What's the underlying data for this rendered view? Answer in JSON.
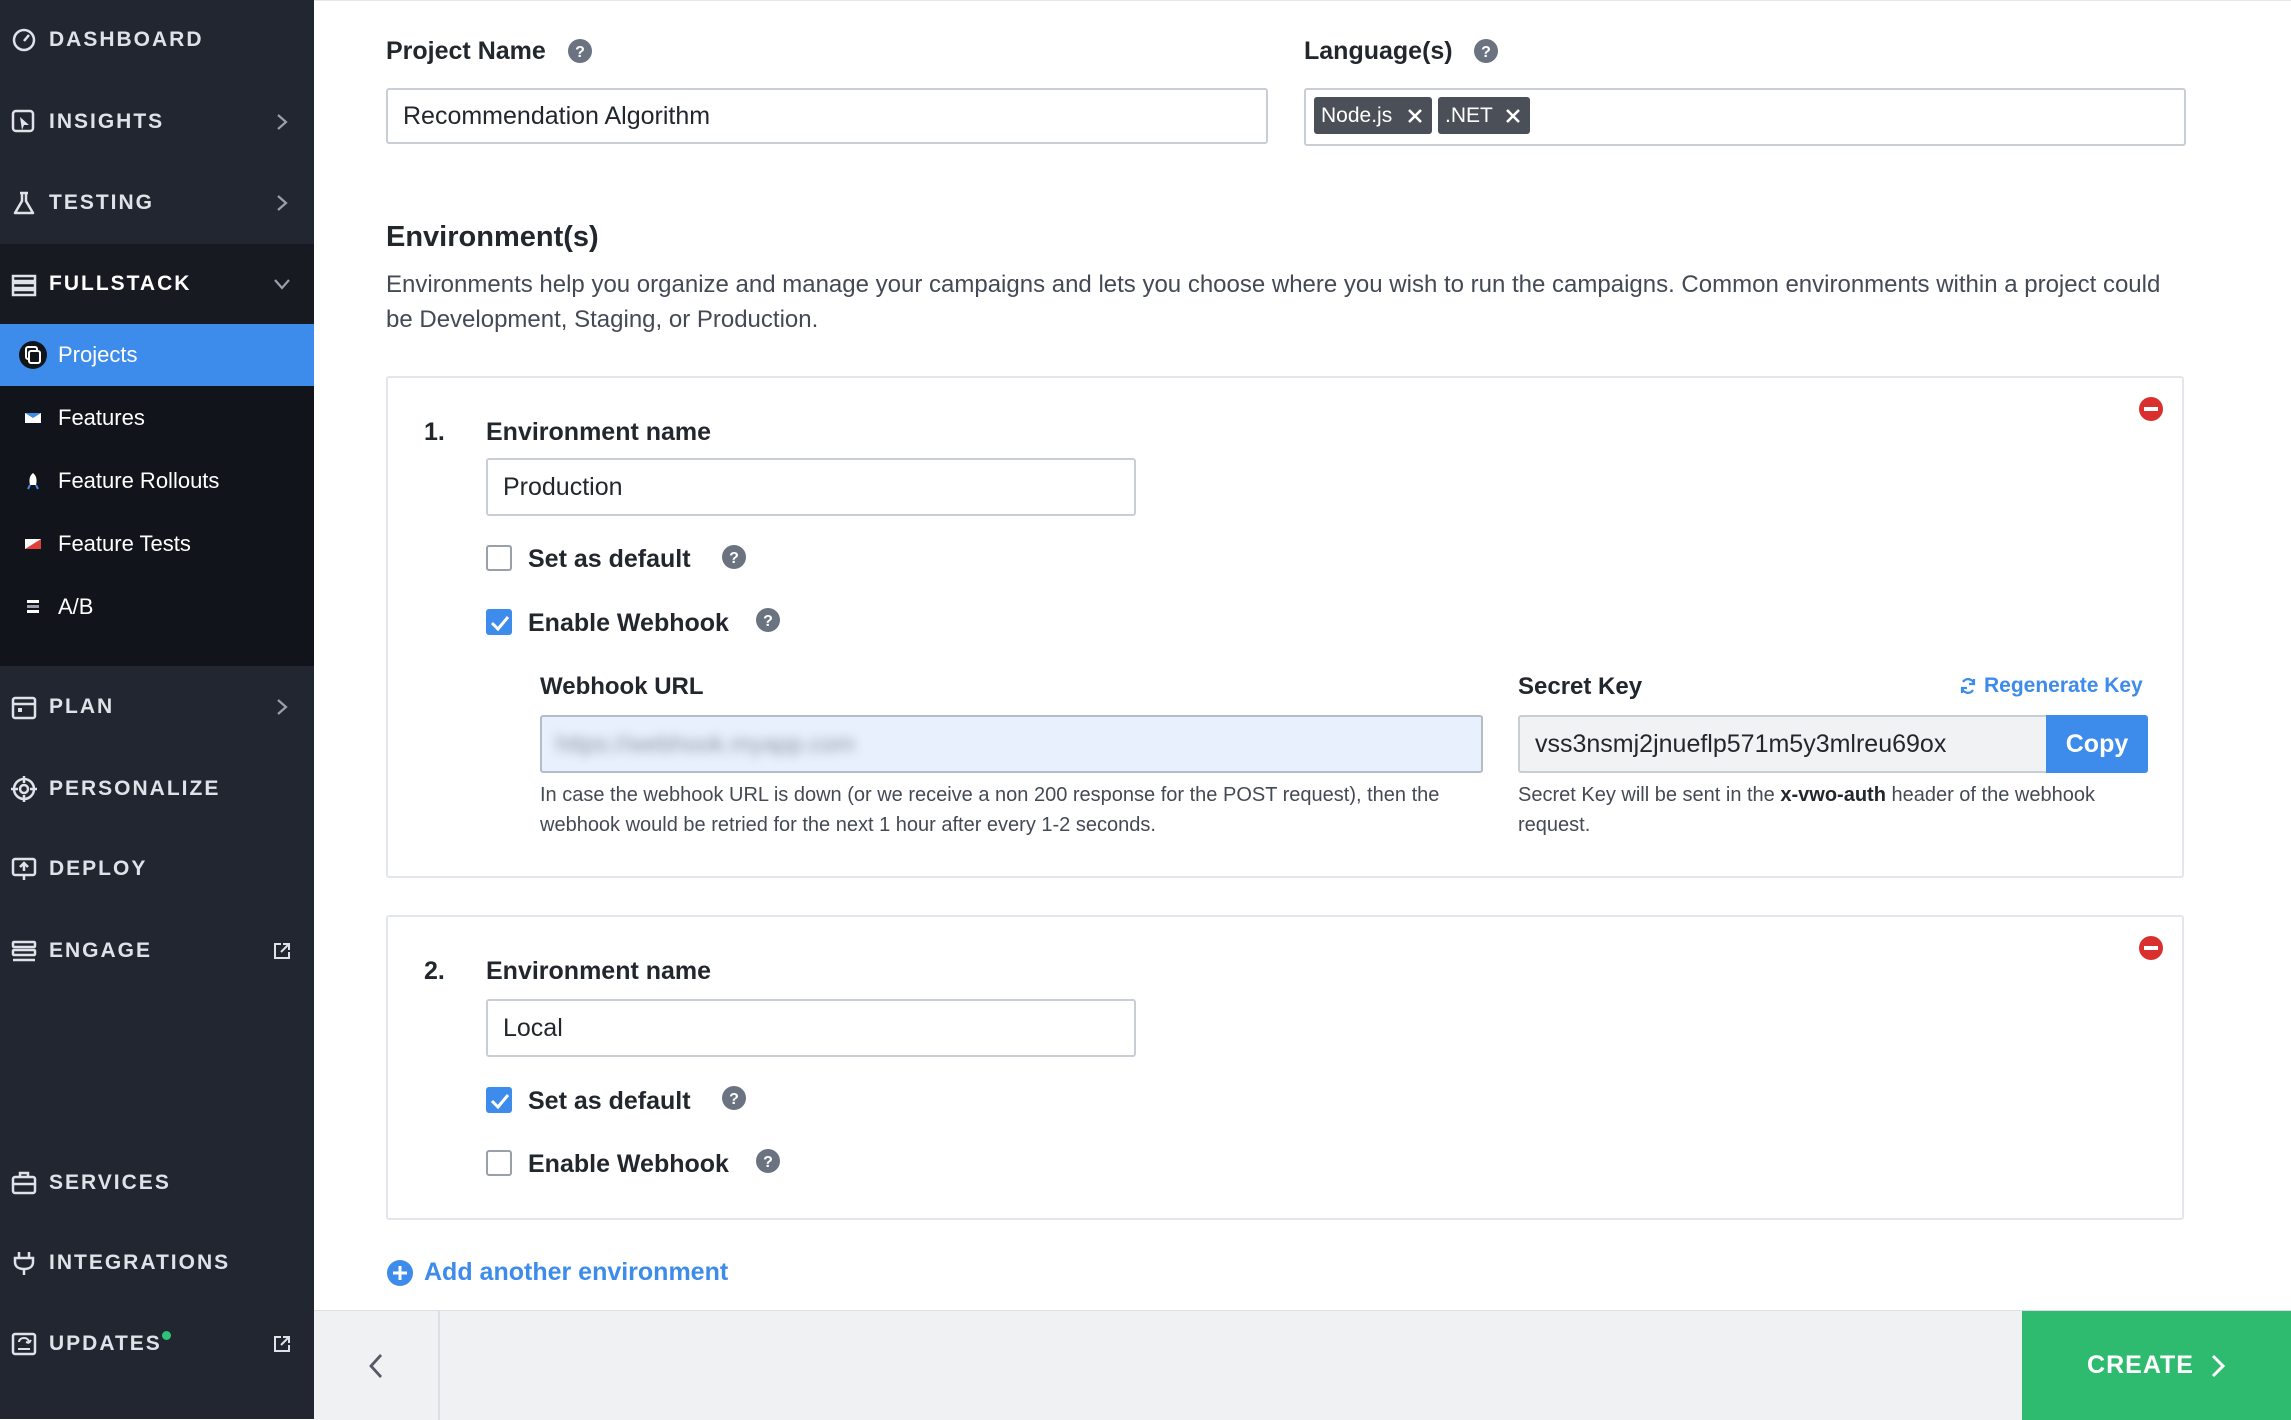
{
  "colors": {
    "sidebar_bg": "#222631",
    "accent_blue": "#3d8bea",
    "create_green": "#2fbb6f",
    "remove_red": "#d9302f",
    "updates_dot": "#2fc37a"
  },
  "sidebar": {
    "items": [
      {
        "label": "DASHBOARD",
        "icon": "gauge-icon"
      },
      {
        "label": "INSIGHTS",
        "icon": "cursor-click-icon"
      },
      {
        "label": "TESTING",
        "icon": "flask-icon"
      },
      {
        "label": "FULLSTACK",
        "icon": "stack-icon",
        "expanded": true
      },
      {
        "label": "PLAN",
        "icon": "calendar-icon"
      },
      {
        "label": "PERSONALIZE",
        "icon": "target-icon"
      },
      {
        "label": "DEPLOY",
        "icon": "deploy-icon"
      },
      {
        "label": "ENGAGE",
        "icon": "engage-icon"
      },
      {
        "label": "SERVICES",
        "icon": "briefcase-icon"
      },
      {
        "label": "INTEGRATIONS",
        "icon": "plug-icon"
      },
      {
        "label": "UPDATES",
        "icon": "updates-icon"
      }
    ],
    "fullstack_sub": [
      {
        "label": "Projects",
        "icon": "projects-icon",
        "active": true
      },
      {
        "label": "Features",
        "icon": "features-icon"
      },
      {
        "label": "Feature Rollouts",
        "icon": "rollouts-icon"
      },
      {
        "label": "Feature Tests",
        "icon": "feature-tests-icon"
      },
      {
        "label": "A/B",
        "icon": "ab-icon"
      }
    ]
  },
  "form": {
    "project_name_label": "Project Name",
    "project_name_value": "Recommendation Algorithm",
    "languages_label": "Language(s)",
    "languages": [
      "Node.js",
      ".NET"
    ],
    "environments_title": "Environment(s)",
    "environments_description": "Environments help you organize and manage your campaigns and lets you choose where you wish to run the campaigns. Common environments within a project could be Development, Staging, or Production."
  },
  "environments": [
    {
      "number": "1.",
      "name_label": "Environment name",
      "name_value": "Production",
      "set_default_label": "Set as default",
      "set_default": false,
      "enable_webhook_label": "Enable Webhook",
      "enable_webhook": true,
      "webhook_url_label": "Webhook URL",
      "webhook_url_value": "https://webhook.myapp.com",
      "webhook_hint": "In case the webhook URL is down (or we receive a non 200 response for the POST request), then the webhook would be retried for the next 1 hour after every 1-2 seconds.",
      "secret_key_label": "Secret Key",
      "regenerate_label": "Regenerate Key",
      "secret_key_value": "vss3nsmj2jnueflp571m5y3mlreu69ox",
      "copy_label": "Copy",
      "secret_hint_before": "Secret Key will be sent in the ",
      "secret_hint_bold": "x-vwo-auth",
      "secret_hint_after": " header of the webhook request."
    },
    {
      "number": "2.",
      "name_label": "Environment name",
      "name_value": "Local",
      "set_default_label": "Set as default",
      "set_default": true,
      "enable_webhook_label": "Enable Webhook",
      "enable_webhook": false
    }
  ],
  "add_environment_label": "Add another environment",
  "footer": {
    "create_label": "CREATE"
  }
}
